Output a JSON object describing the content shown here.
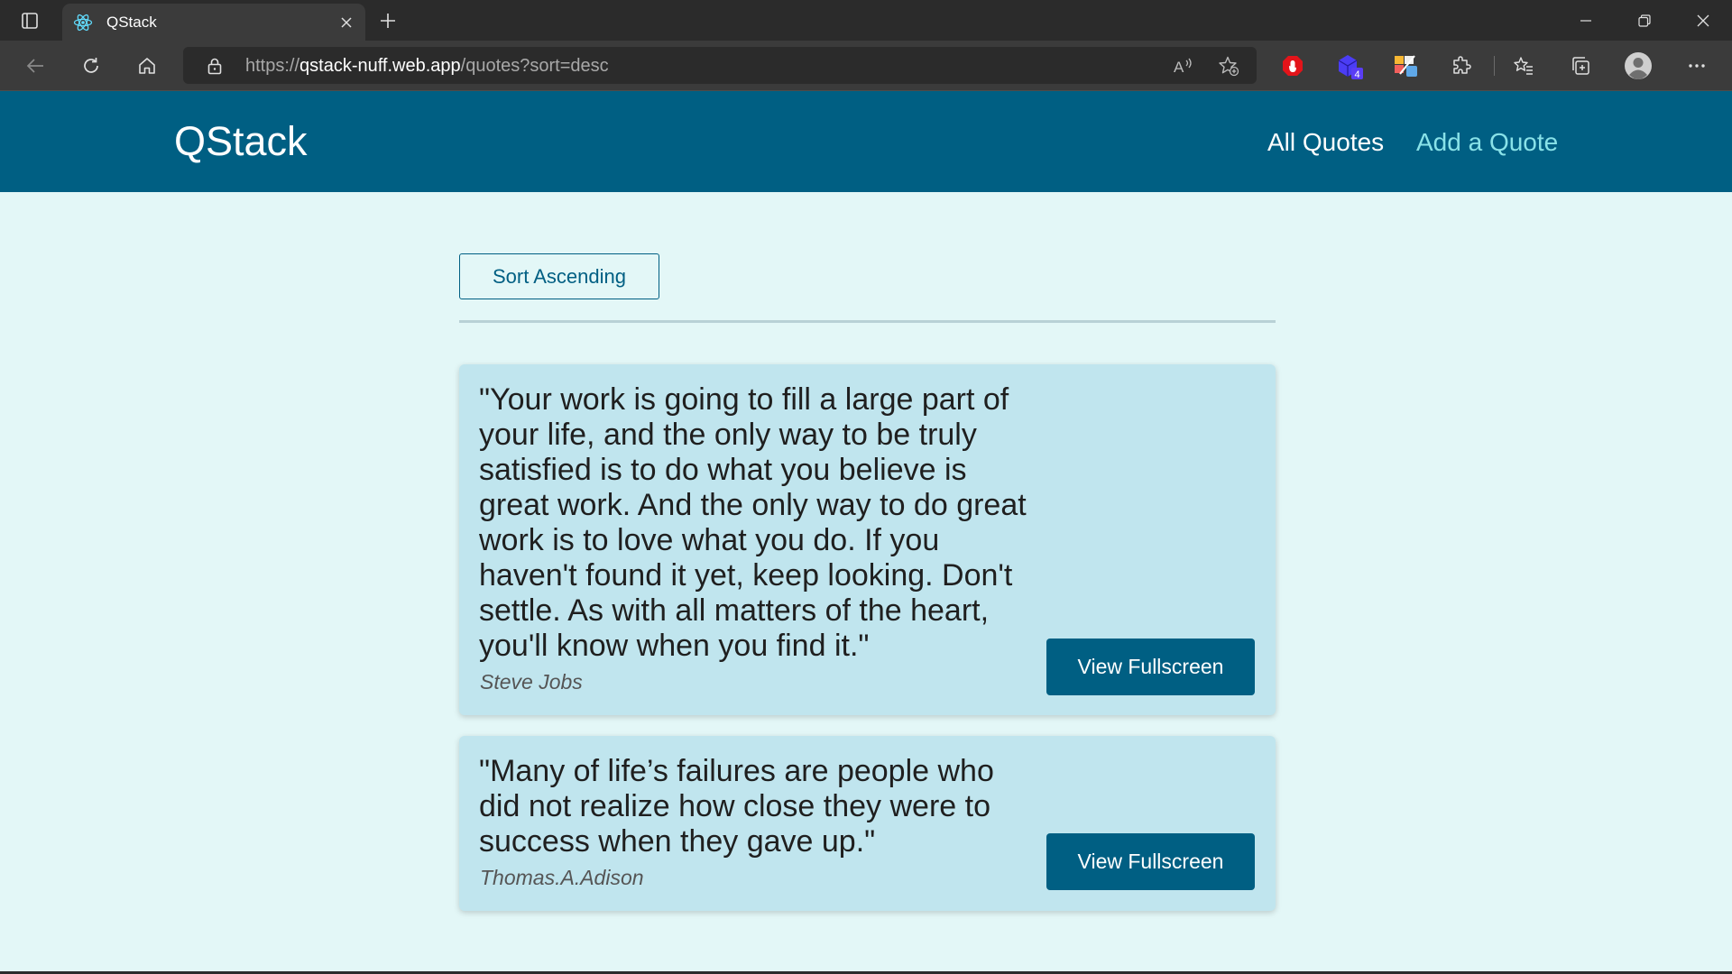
{
  "browser": {
    "tab": {
      "title": "QStack",
      "favicon": "react-atom-icon"
    },
    "address_bar": {
      "protocol": "https://",
      "host": "qstack-nuff.web.app",
      "path": "/quotes?sort=desc"
    },
    "extensions_badge": "4",
    "icons": [
      "tab-actions-icon",
      "close-icon",
      "plus-icon",
      "minimize-icon",
      "restore-icon",
      "close-window-icon",
      "back-icon",
      "refresh-icon",
      "home-icon",
      "lock-icon",
      "read-aloud-icon",
      "add-favorite-icon",
      "adblock-icon",
      "extension-cube-icon",
      "extension-paint-icon",
      "puzzle-icon",
      "favorites-icon",
      "collections-icon",
      "profile-icon",
      "more-icon"
    ]
  },
  "app": {
    "logo": "QStack",
    "nav": {
      "all_quotes": "All Quotes",
      "add_quote": "Add a Quote"
    },
    "sort_button": "Sort Ascending",
    "quotes": [
      {
        "text": "\"Your work is going to fill a large part of your life, and the only way to be truly satisfied is to do what you believe is great work. And the only way to do great work is to love what you do. If you haven't found it yet, keep looking. Don't settle. As with all matters of the heart, you'll know when you find it.\"",
        "author": "Steve Jobs",
        "button": "View Fullscreen"
      },
      {
        "text": "\"Many of life’s failures are people who did not realize how close they were to success when they gave up.\"",
        "author": "Thomas.A.Adison",
        "button": "View Fullscreen"
      }
    ]
  },
  "colors": {
    "header_bg": "#005f83",
    "page_bg": "#e3f7f7",
    "card_bg": "#c0e5ee",
    "nav_active": "#89e2e8"
  }
}
